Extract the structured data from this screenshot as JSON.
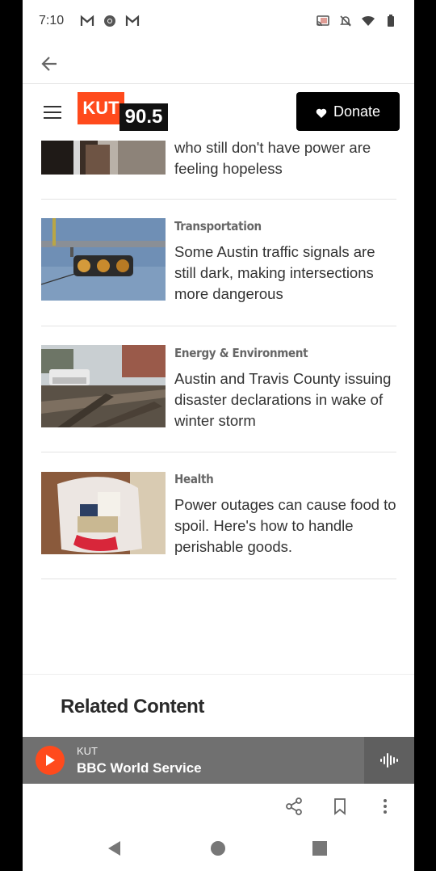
{
  "status_bar": {
    "time": "7:10",
    "icons": [
      "gmail-icon",
      "chrome-icon",
      "gmail-icon",
      "cast-icon",
      "notifications-off-icon",
      "wifi-icon",
      "battery-icon"
    ]
  },
  "header": {
    "logo_text": "KUT",
    "logo_freq": "90.5",
    "donate_label": "Donate",
    "accent": "#ff4a1c"
  },
  "articles": [
    {
      "category": "",
      "headline": "who still don't have power are feeling hopeless",
      "thumb": "dark-room-photo"
    },
    {
      "category": "Transportation",
      "headline": "Some Austin traffic signals are still dark, making intersections more dangerous",
      "thumb": "traffic-signal-photo"
    },
    {
      "category": "Energy & Environment",
      "headline": "Austin and Travis County issuing disaster declarations in wake of winter storm",
      "thumb": "fallen-tree-photo"
    },
    {
      "category": "Health",
      "headline": "Power outages can cause food to spoil. Here's how to handle perishable goods.",
      "thumb": "food-bag-photo"
    }
  ],
  "related": {
    "title": "Related Content"
  },
  "player": {
    "station": "KUT",
    "program": "BBC World Service"
  },
  "toolbar": {
    "icons": [
      "share-icon",
      "bookmark-icon",
      "more-vert-icon"
    ]
  },
  "navbar": {
    "icons": [
      "nav-back-icon",
      "nav-home-icon",
      "nav-recents-icon"
    ]
  }
}
